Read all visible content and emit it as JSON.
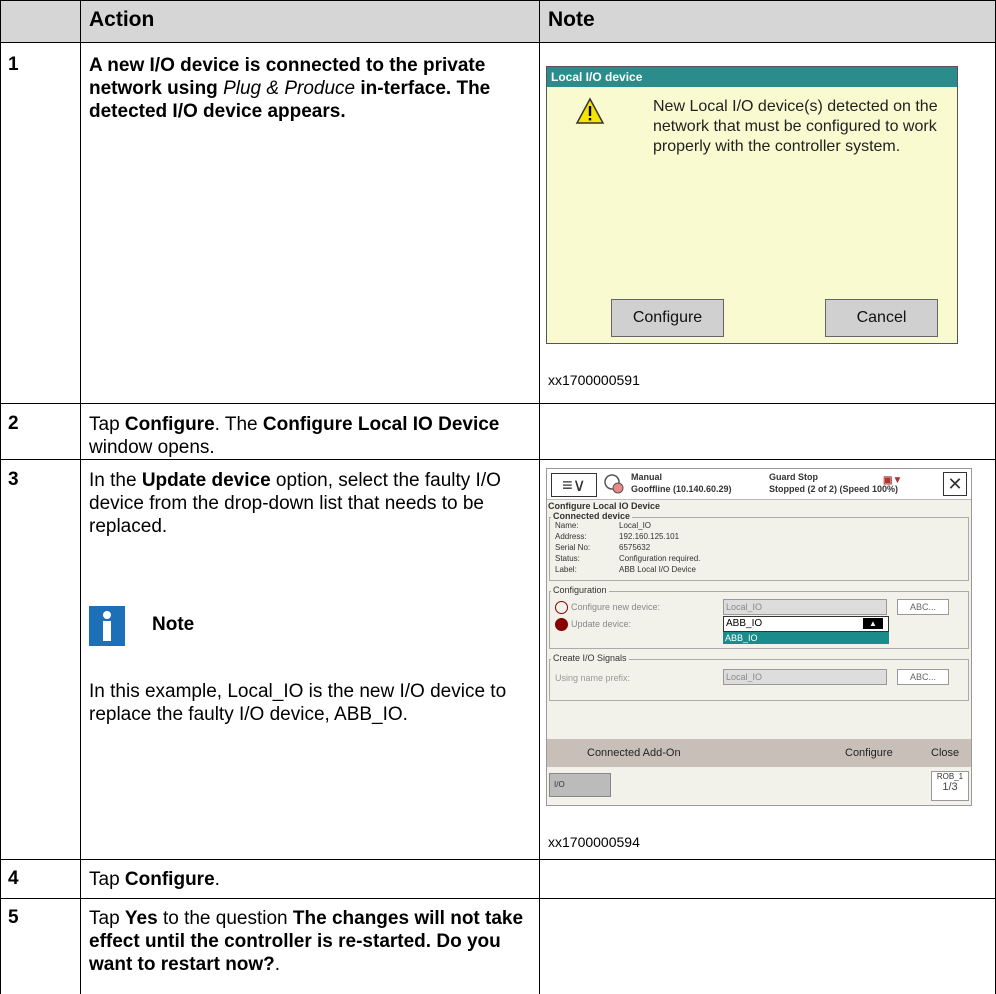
{
  "header": {
    "action": "Action",
    "note": "Note"
  },
  "rows": [
    {
      "num": "1",
      "action_part1": "A new I/O device is connected to the private network using ",
      "action_italic": "Plug & Produce",
      "action_part2": " in-terface. The detected I/O device appears.",
      "caption": "xx1700000591"
    },
    {
      "num": "2",
      "action_prefix": "Tap ",
      "action_bold1": "Configure",
      "action_mid": ". The ",
      "action_bold2": "Configure Local IO Device",
      "action_suffix": " window opens."
    },
    {
      "num": "3",
      "action_prefix": "In the ",
      "action_bold1": "Update device",
      "action_suffix": " option, select the faulty I/O device from the drop-down list that needs to be replaced.",
      "note_label": "Note",
      "note_text": "In this example, Local_IO is the new I/O device to replace the faulty I/O device, ABB_IO.",
      "caption": "xx1700000594"
    },
    {
      "num": "4",
      "action_prefix": "Tap ",
      "action_bold1": "Configure",
      "action_suffix": "."
    },
    {
      "num": "5",
      "action_prefix": "Tap ",
      "action_bold1": "Yes",
      "action_mid": " to the question ",
      "action_bold2": "The changes will not take effect until the controller is re-started. Do you want to restart now?",
      "action_suffix": "."
    }
  ],
  "dialog": {
    "title": "Local I/O device",
    "message": "New Local I/O device(s) detected on the network that must be configured to work properly with the controller system.",
    "configure_label": "Configure",
    "cancel_label": "Cancel"
  },
  "flexpendant": {
    "menu_glyph": "≡∨",
    "status_mode": "Manual",
    "status_host": "Gooffline (10.140.60.29)",
    "status_stop": "Guard Stop",
    "status_state": "Stopped (2 of 2) (Speed 100%)",
    "close_glyph": "✕",
    "window_title": "Configure Local IO Device",
    "connected_legend": "Connected device",
    "fields": [
      {
        "label": "Name:",
        "value": "Local_IO"
      },
      {
        "label": "Address:",
        "value": "192.160.125.101"
      },
      {
        "label": "Serial No:",
        "value": "6575632"
      },
      {
        "label": "Status:",
        "value": "Configuration required."
      },
      {
        "label": "Label:",
        "value": "ABB Local I/O Device"
      }
    ],
    "configuration_legend": "Configuration",
    "configure_new_label": "Configure new device:",
    "configure_new_value": "Local_IO",
    "abc_label": "ABC...",
    "update_label": "Update device:",
    "update_value": "ABB_IO",
    "update_option": "ABB_IO",
    "signals_legend": "Create I/O Signals",
    "prefix_label": "Using name prefix:",
    "prefix_value": "Local_IO",
    "bottom_connected": "Connected Add-On",
    "bottom_configure": "Configure",
    "bottom_close": "Close",
    "task_label": "I/O",
    "rob_label": "ROB_1",
    "rob_fraction": "1/3"
  },
  "colors": {
    "header_bg": "#d6d6d6",
    "dialog_bg": "#fafad0",
    "dialog_title": "#2b8c8c",
    "note_icon": "#1d6fb8",
    "selected_option": "#1a8c8c"
  }
}
